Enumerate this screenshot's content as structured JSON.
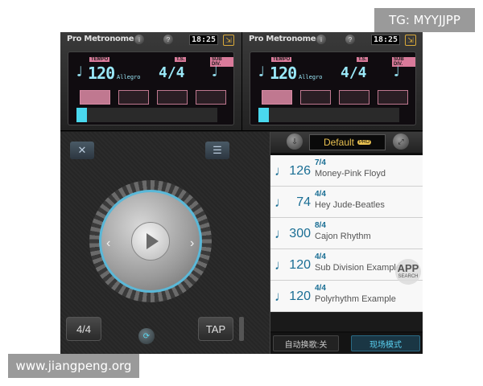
{
  "watermarks": {
    "top": "TG: MYYJJPP",
    "bottom": "www.jiangpeng.org"
  },
  "header": {
    "app_name": "Pro Metronome",
    "app_name_fade": "",
    "clock": "18:25",
    "info_glyph": "i",
    "help_glyph": "?",
    "screen_glyph": "⇲"
  },
  "lcd": {
    "tempo_tag": "TEMPO",
    "ts_tag": "T.S.",
    "subdiv_tag": "SUB DIV.",
    "note_glyph": "♩",
    "tempo": "120",
    "tempo_name": "Allegro",
    "time_signature": "4/4",
    "subdiv_glyph": "♩",
    "beats": 4,
    "active_beat": 1
  },
  "controls": {
    "settings_icon": "✕",
    "list_icon": "☰",
    "prev_arrow": "‹",
    "next_arrow": "›",
    "time_signature_button": "4/4",
    "tap_button": "TAP",
    "link_glyph": "⟳"
  },
  "preset_list": {
    "header_name": "Default",
    "pro_label": "PRO",
    "left_btn_glyph": "⇩",
    "right_btn_glyph": "⤢",
    "rows": [
      {
        "note": "♩",
        "bpm": "126",
        "sig": "7/4",
        "name": "Money-Pink Floyd"
      },
      {
        "note": "♩",
        "bpm": "74",
        "sig": "4/4",
        "name": "Hey Jude-Beatles"
      },
      {
        "note": "♩",
        "bpm": "300",
        "sig": "8/4",
        "name": "Cajon Rhythm"
      },
      {
        "note": "♩",
        "bpm": "120",
        "sig": "4/4",
        "name": "Sub Division Example"
      },
      {
        "note": "♩",
        "bpm": "120",
        "sig": "4/4",
        "name": "Polyrhythm Example"
      }
    ],
    "auto_switch": "自动换歌:关",
    "live_mode": "现场模式"
  },
  "overlay": {
    "big": "APP",
    "small": "SEARCH"
  },
  "colors": {
    "lcd_cyan": "#9ae8f8",
    "beat_pink": "#c07890",
    "accent_blue": "#4ad8ee",
    "preset_gold": "#e8c050"
  }
}
